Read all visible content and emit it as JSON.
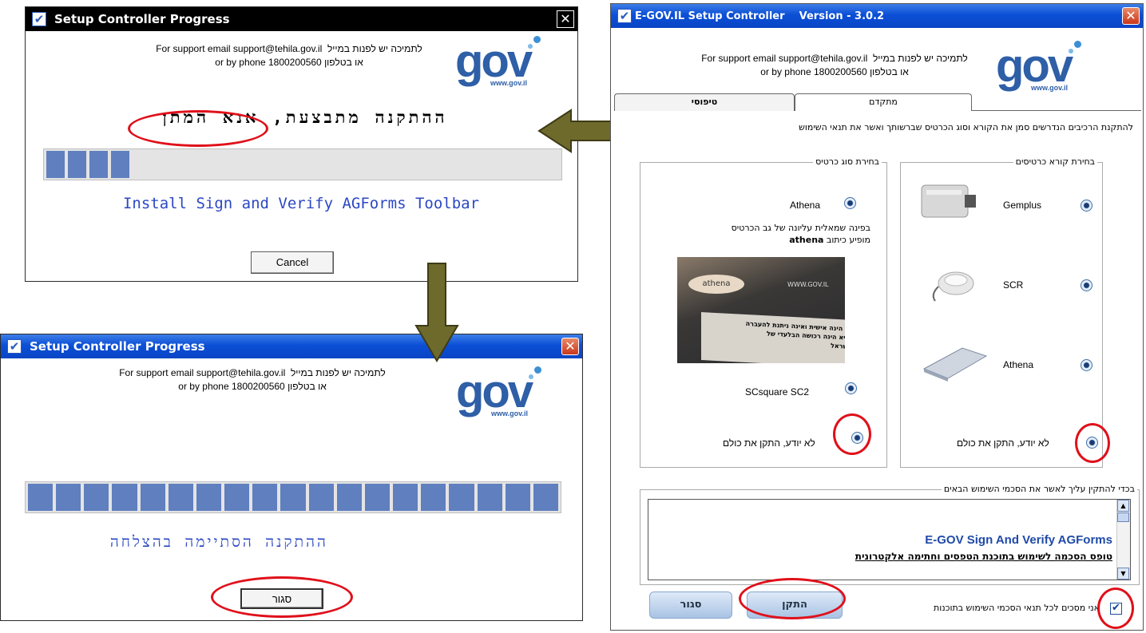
{
  "colors": {
    "accent_blue": "#2e5fa7",
    "progress_fill": "#5f7fbf",
    "highlight_red": "#e0101a",
    "arrow_olive": "#6e6a2c"
  },
  "support": {
    "he_line1": "לתמיכה יש לפנות במייל",
    "en_line1": "For support email support@tehila.gov.il",
    "en_line2": "or by phone 1800200560",
    "he_line2": "או בטלפון"
  },
  "logo": {
    "word": "gov",
    "url": "www.gov.il"
  },
  "progress_window_1": {
    "title": "Setup Controller Progress",
    "status_he": "ההתקנה מתבצעת, אנא המתן",
    "progress_segments": 4,
    "step_text": "Install Sign and Verify AGForms Toolbar",
    "cancel_label": "Cancel"
  },
  "progress_window_2": {
    "title": "Setup Controller Progress",
    "progress_segments": 19,
    "done_text_he": "ההתקנה הסתיימה בהצלחה",
    "close_label": "סגור"
  },
  "main_window": {
    "title": "E-GOV.IL Setup Controller",
    "version": "Version - 3.0.2",
    "tabs": [
      {
        "label": "טיפוסי"
      },
      {
        "label": "מתקדם"
      }
    ],
    "instruction": "להתקנת הרכיבים הנדרשים סמן את הקורא וסוג הכרטיס שברשותך ואשר את תנאי השימוש",
    "reader_group": {
      "legend": "בחירת קורא כרטיסים",
      "options": [
        {
          "label": "Gemplus"
        },
        {
          "label": "SCR"
        },
        {
          "label": "Athena"
        },
        {
          "label": "לא יודע, התקן את כולם"
        }
      ]
    },
    "card_group": {
      "legend": "בחירת סוג כרטיס",
      "options": [
        {
          "label": "Athena"
        },
        {
          "label": "SCsquare SC2"
        },
        {
          "label": "לא יודע, התקן את כולם"
        }
      ],
      "hint_line1": "בפינה שמאלית עליונה של גב הכרטיס",
      "hint_line2": "מופיע כיתוב",
      "hint_bold": "athena",
      "card_image_label": "athena",
      "card_image_url": "WWW.GOV.IL",
      "card_image_text_1": "זו הינה אישית ואינה ניתנת להעברה",
      "card_image_text_2": "היא הינה רכושה הבלעדי של",
      "card_image_text_3": "ישראל"
    },
    "terms": {
      "legend": "בכדי להתקין עליך לאשר את הסכמי השימוש הבאים",
      "heading_en": "E-GOV Sign And Verify AGForms",
      "heading_he": "טופס הסכמה לשימוש בתוכנת הטפסים וחתימה אלקטרונית"
    },
    "agree_label": "אני מסכים לכל תנאי הסכמי השימוש בתוכנות",
    "agree_checked": true,
    "install_label": "התקן",
    "close_label": "סגור"
  }
}
